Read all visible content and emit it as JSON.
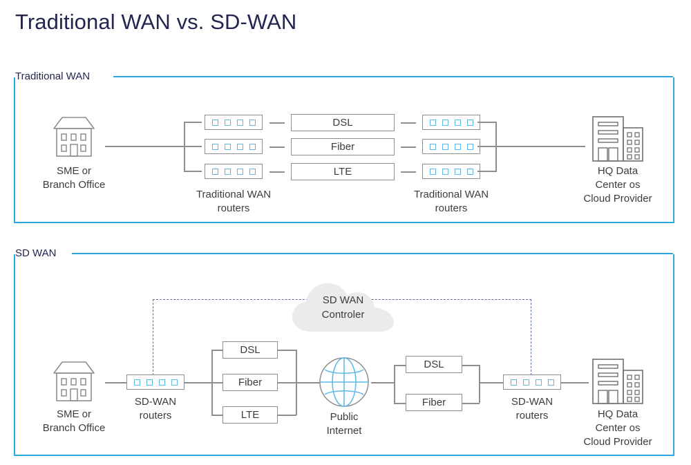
{
  "page": {
    "title": "Traditional WAN vs. SD-WAN",
    "accent_color": "#2aa8e0",
    "title_color": "#22254f",
    "line_color": "#8d8d8d",
    "led_color": "#5bb7e8",
    "dashed_color": "#5c6a9a",
    "cloud_fill": "#ebebeb"
  },
  "sections": {
    "traditional": {
      "label": "Traditional WAN",
      "left_node": {
        "icon": "house-icon",
        "caption": "SME or\nBranch Office"
      },
      "left_routers": {
        "caption": "Traditional WAN\nrouters",
        "count": 3,
        "leds_per_router": 4
      },
      "links": [
        {
          "label": "DSL"
        },
        {
          "label": "Fiber"
        },
        {
          "label": "LTE"
        }
      ],
      "right_routers": {
        "caption": "Traditional WAN\nrouters",
        "count": 3,
        "leds_per_router": 4
      },
      "right_node": {
        "icon": "office-building-icon",
        "caption": "HQ Data\nCenter os\nCloud Provider"
      }
    },
    "sdwan": {
      "label": "SD WAN",
      "controller": {
        "icon": "cloud-icon",
        "caption": "SD WAN\nControler"
      },
      "left_node": {
        "icon": "house-icon",
        "caption": "SME or\nBranch Office"
      },
      "left_router": {
        "caption": "SD-WAN\nrouters",
        "leds": 4
      },
      "left_links": [
        {
          "label": "DSL"
        },
        {
          "label": "Fiber"
        },
        {
          "label": "LTE"
        }
      ],
      "internet": {
        "icon": "globe-icon",
        "caption": "Public\nInternet"
      },
      "right_links": [
        {
          "label": "DSL"
        },
        {
          "label": "Fiber"
        }
      ],
      "right_router": {
        "caption": "SD-WAN\nrouters",
        "leds": 4
      },
      "right_node": {
        "icon": "office-building-icon",
        "caption": "HQ Data\nCenter os\nCloud Provider"
      }
    }
  }
}
